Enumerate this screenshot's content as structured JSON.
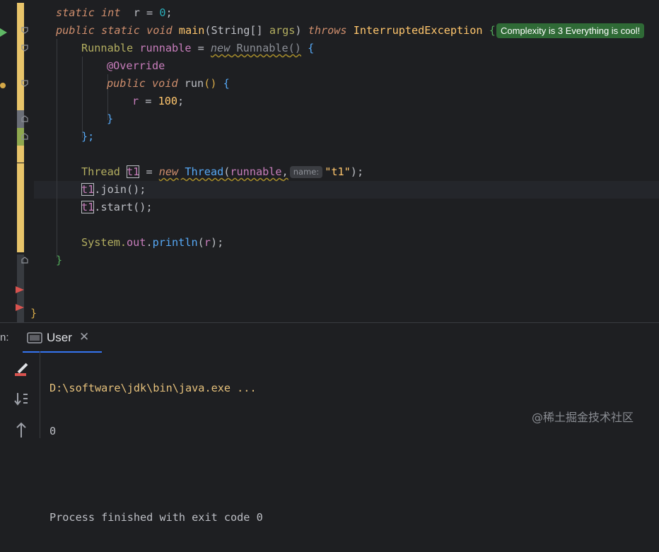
{
  "editor": {
    "complexity_badge": "Complexity is 3 Everything is cool!",
    "param_hint": "name:",
    "lines": {
      "l1": {
        "kw1": "static",
        "kw2": "int",
        "rest": "  r = ",
        "num": "0",
        "end": ";"
      },
      "l2": {
        "kw1": "public",
        "kw2": "static",
        "kw3": "void",
        "fn": "main",
        "p1": "(String[] ",
        "arg": "args",
        "p2": ") ",
        "throws": "throws",
        "exc": " InterruptedException ",
        "brace": "{"
      },
      "l3": {
        "type": "Runnable",
        "var": "runnable",
        "eq": " = ",
        "new": "new",
        "cls": "Runnable",
        "paren": "()",
        "brace": "{"
      },
      "l4": {
        "ann": "@Override"
      },
      "l5": {
        "kw1": "public",
        "kw2": "void",
        "fn": "run",
        "paren": "()",
        "brace": "{"
      },
      "l6": {
        "var": "r",
        "eq": " = ",
        "num": "100",
        "end": ";"
      },
      "l7": {
        "brace": "}"
      },
      "l8": {
        "text": "};"
      },
      "l9": {
        "type": "Thread",
        "var": "t1",
        "eq": " = ",
        "new": "new",
        "cls": "Thread",
        "po": "(",
        "arg": "runnable",
        "comma": ",",
        "str": "\"t1\"",
        "pc": ")",
        "end": ";"
      },
      "l10": {
        "var": "t1",
        "rest": ".join();"
      },
      "l11": {
        "var": "t1",
        "rest": ".start();"
      },
      "l12": {
        "sys": "System.",
        "out": "out",
        "dot": ".",
        "fn": "println",
        "po": "(",
        "arg": "r",
        "pc": ")",
        "end": ";"
      },
      "l13": {
        "brace": "}"
      },
      "l14": {
        "brace": "}"
      }
    }
  },
  "run_panel": {
    "label_prefix": "n:",
    "tab_label": "User",
    "tab_close": "✕",
    "icons": [
      "terminal-icon",
      "clear-icon",
      "scroll-to-end-icon",
      "up-arrow-icon"
    ],
    "output": [
      "D:\\software\\jdk\\bin\\java.exe ...",
      "0",
      "",
      "Process finished with exit code 0"
    ]
  },
  "watermark": "@稀土掘金技术社区",
  "colors": {
    "background": "#1e1f22",
    "change_bar": "#e8c46a",
    "badge": "#2f6a36",
    "tab_underline": "#3574f0"
  }
}
